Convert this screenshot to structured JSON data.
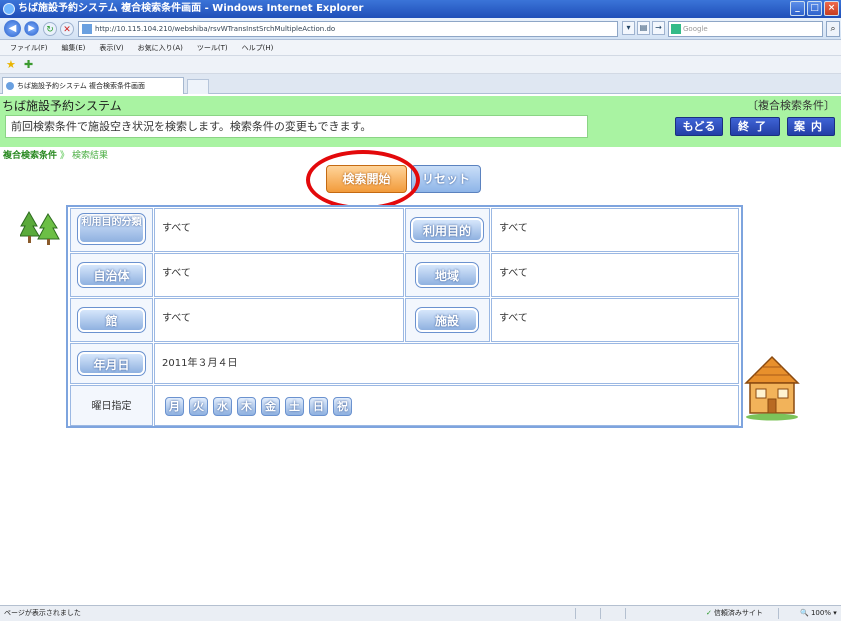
{
  "browser": {
    "title": "ちば施設予約システム 複合検索条件画面 - Windows Internet Explorer",
    "address": "http://10.115.104.210/webshiba/rsvWTransInstSrchMultipleAction.do",
    "search_placeholder": "Google",
    "menu": [
      "ファイル(F)",
      "編集(E)",
      "表示(V)",
      "お気に入り(A)",
      "ツール(T)",
      "ヘルプ(H)"
    ],
    "tab_label": "ちば施設予約システム 複合検索条件画面",
    "status_left": "ページが表示されました",
    "status_zone": "信頼済みサイト",
    "status_zoom": "100%"
  },
  "header": {
    "system_name": "ちば施設予約システム",
    "mode": "〔複合検索条件〕",
    "message": "前回検索条件で施設空き状況を検索します。検索条件の変更もできます。",
    "back_label": "もどる",
    "end_label": "終了",
    "guide_label": "案内"
  },
  "breadcrumb": {
    "item1": "複合検索条件",
    "separator": "》",
    "item2": "検索結果"
  },
  "actions": {
    "start_label": "検索開始",
    "reset_label": "リセット"
  },
  "form": {
    "purpose_category_label": "利用目的分類",
    "purpose_category_value": "すべて",
    "purpose_label": "利用目的",
    "purpose_value": "すべて",
    "municipality_label": "自治体",
    "municipality_value": "すべて",
    "area_label": "地域",
    "area_value": "すべて",
    "building_label": "館",
    "building_value": "すべて",
    "facility_label": "施設",
    "facility_value": "すべて",
    "date_label": "年月日",
    "date_value": "2011年３月４日",
    "weekday_label": "曜日指定",
    "weekdays": [
      "月",
      "火",
      "水",
      "木",
      "金",
      "土",
      "日",
      "祝"
    ]
  },
  "colors": {
    "header_green": "#a9f3a2",
    "accent_blue": "#233fa6",
    "start_orange": "#f29b3b",
    "highlight_red": "#e3090b"
  }
}
